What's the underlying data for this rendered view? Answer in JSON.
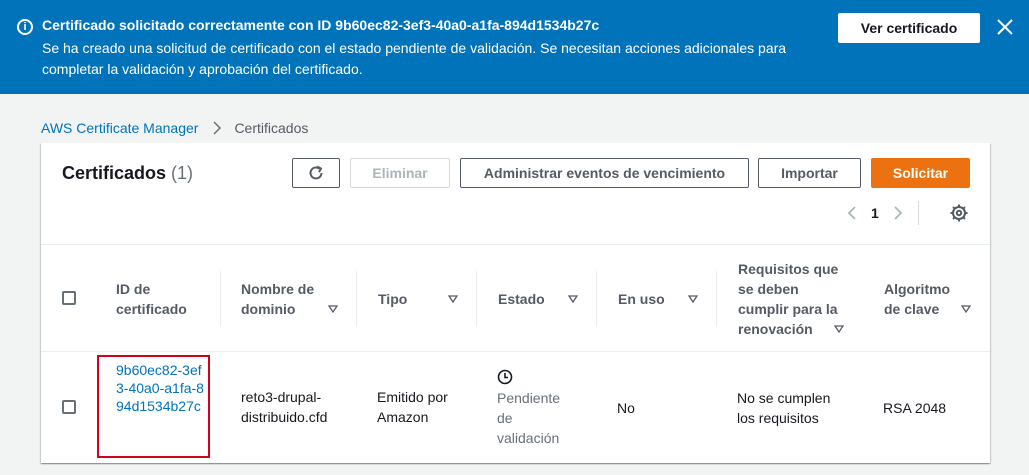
{
  "flash": {
    "title": "Certificado solicitado correctamente con ID 9b60ec82-3ef3-40a0-a1fa-894d1534b27c",
    "message": "Se ha creado una solicitud de certificado con el estado pendiente de validación. Se necesitan acciones adicionales para completar la validación y aprobación del certificado.",
    "button_label": "Ver certificado",
    "icon": "info-icon",
    "color": "#0073bb"
  },
  "breadcrumb": {
    "items": [
      "AWS Certificate Manager",
      "Certificados"
    ]
  },
  "panel": {
    "title": "Certificados",
    "count": "(1)",
    "buttons": {
      "refresh_icon": "refresh-icon",
      "delete": "Eliminar",
      "manage_events": "Administrar eventos de vencimiento",
      "import": "Importar",
      "request": "Solicitar"
    },
    "pagination": {
      "page": "1"
    },
    "accent_color": "#ec7211"
  },
  "table": {
    "columns": [
      "ID de certificado",
      "Nombre de dominio",
      "Tipo",
      "Estado",
      "En uso",
      "Requisitos que se deben cumplir para la renovación",
      "Algoritmo de clave"
    ],
    "rows": [
      {
        "id": "9b60ec82-3ef3-40a0-a1fa-894d1534b27c",
        "domain": "reto3-drupal-distribuido.cfd",
        "type": "Emitido por Amazon",
        "status": "Pendiente de validación",
        "in_use": "No",
        "renewal": "No se cumplen los requisitos",
        "algorithm": "RSA 2048"
      }
    ]
  }
}
